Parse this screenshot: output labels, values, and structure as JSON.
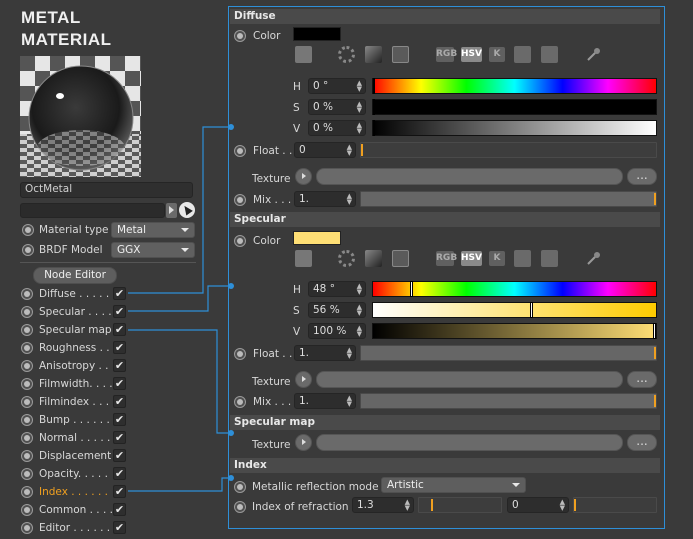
{
  "material": {
    "title_line1": "METAL",
    "title_line2": "MATERIAL",
    "name": "OctMetal"
  },
  "left": {
    "material_type_label": "Material type",
    "material_type_value": "Metal",
    "brdf_label": "BRDF Model",
    "brdf_value": "GGX",
    "node_editor": "Node Editor",
    "check": "✔",
    "channels": [
      {
        "label": "Diffuse . . . . ."
      },
      {
        "label": "Specular . . . ."
      },
      {
        "label": "Specular map"
      },
      {
        "label": "Roughness . ."
      },
      {
        "label": "Anisotropy . ."
      },
      {
        "label": "Filmwidth. . . ."
      },
      {
        "label": "Filmindex . . . ."
      },
      {
        "label": "Bump . . . . . ."
      },
      {
        "label": "Normal . . . . ."
      },
      {
        "label": "Displacement"
      },
      {
        "label": "Opacity. . . . ."
      },
      {
        "label": "Index . . . . . ."
      },
      {
        "label": "Common . . . ."
      },
      {
        "label": "Editor . . . . . ."
      }
    ]
  },
  "diffuse": {
    "header": "Diffuse",
    "color_label": "Color",
    "color": "#000000",
    "modes": [
      "RGB",
      "HSV",
      "K"
    ],
    "h_label": "H",
    "h_value": "0 °",
    "s_label": "S",
    "s_value": "0 %",
    "v_label": "V",
    "v_value": "0 %",
    "float_label": "Float . .",
    "float_value": "0",
    "texture_label": "Texture",
    "dots": "...",
    "mix_label": "Mix . . .",
    "mix_value": "1."
  },
  "specular": {
    "header": "Specular",
    "color_label": "Color",
    "color": "#ffdf75",
    "modes": [
      "RGB",
      "HSV",
      "K"
    ],
    "h_label": "H",
    "h_value": "48 °",
    "s_label": "S",
    "s_value": "56 %",
    "v_label": "V",
    "v_value": "100 %",
    "float_label": "Float . .",
    "float_value": "1.",
    "texture_label": "Texture",
    "dots": "...",
    "mix_label": "Mix . . .",
    "mix_value": "1."
  },
  "specular_map": {
    "header": "Specular map",
    "texture_label": "Texture",
    "dots": "..."
  },
  "index": {
    "header": "Index",
    "mode_label": "Metallic reflection mode",
    "mode_value": "Artistic",
    "ior_label": "Index of refraction",
    "ior_value": "1.3",
    "ior_value2": "0"
  },
  "colors": {
    "accent": "#2e8fd8",
    "index_highlight": "#f0a020",
    "slider_marker": "#f0a020"
  }
}
